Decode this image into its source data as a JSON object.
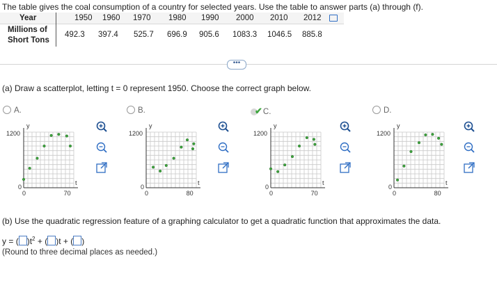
{
  "intro": "The table gives the coal consumption of a country for selected years. Use the table to answer parts (a) through (f).",
  "table": {
    "row1_label": "Year",
    "row2_label_line1": "Millions of",
    "row2_label_line2": "Short Tons",
    "years": [
      "1950",
      "1960",
      "1970",
      "1980",
      "1990",
      "2000",
      "2010",
      "2012"
    ],
    "tons": [
      "492.3",
      "397.4",
      "525.7",
      "696.9",
      "905.6",
      "1083.3",
      "1046.5",
      "885.8"
    ]
  },
  "more_label": "•••",
  "part_a": "(a) Draw a scatterplot, letting t = 0 represent 1950. Choose the correct graph below.",
  "options": [
    {
      "label": "A.",
      "y_max_label": "1200",
      "y_label": "y",
      "x_label": "t",
      "origin": "0",
      "x_max_label": "70",
      "selected": false
    },
    {
      "label": "B.",
      "y_max_label": "1200",
      "y_label": "y",
      "x_label": "t",
      "origin": "0",
      "x_max_label": "80",
      "selected": false
    },
    {
      "label": "C.",
      "y_max_label": "1200",
      "y_label": "y",
      "x_label": "t",
      "origin": "0",
      "x_max_label": "70",
      "selected": true
    },
    {
      "label": "D.",
      "y_max_label": "1200",
      "y_label": "y",
      "x_label": "t",
      "origin": "0",
      "x_max_label": "80",
      "selected": false
    }
  ],
  "part_b": "(b) Use the quadratic regression feature of a graphing calculator to get a quadratic function that approximates the data.",
  "equation": {
    "lhs": "y =",
    "t2": "t",
    "sup": "2",
    "plus1": "+",
    "t": "t +",
    "open": "(",
    "close": ")"
  },
  "round_note": "(Round to three decimal places as needed.)",
  "colors": {
    "accent": "#2f6ec4",
    "point": "#3ea53e",
    "grid": "#c9c9c9"
  }
}
